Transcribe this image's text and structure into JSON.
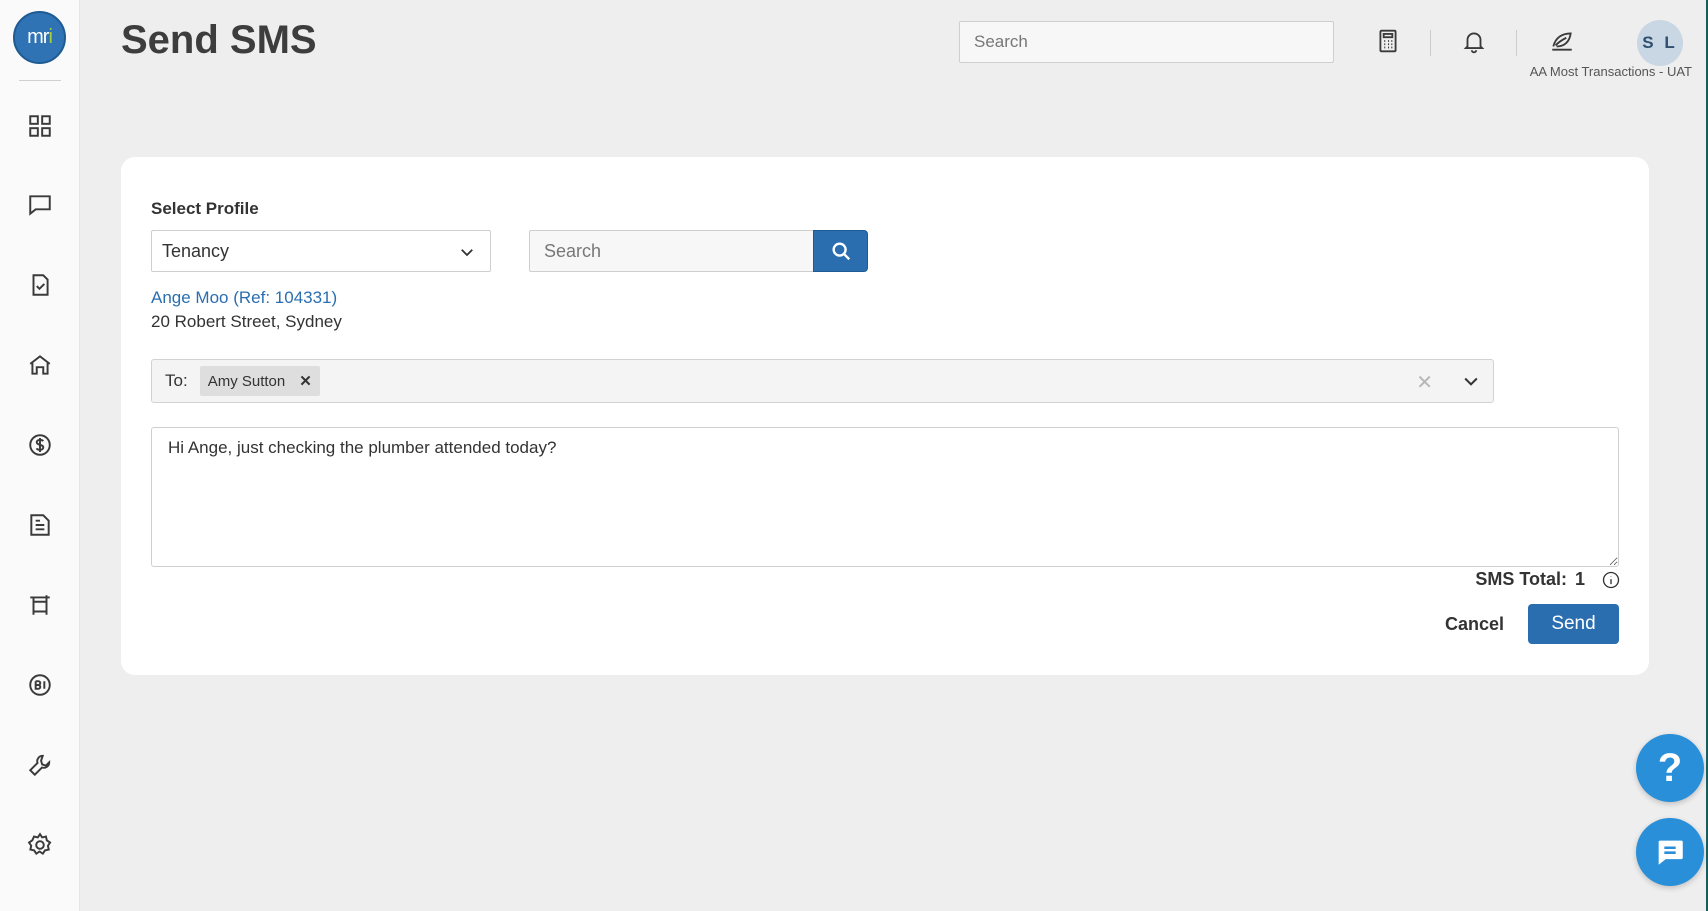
{
  "app": {
    "logo_text": "mri",
    "page_title": "Send SMS",
    "account_name": "AA Most Transactions - UAT",
    "user_initials": "S L"
  },
  "header": {
    "search_placeholder": "Search",
    "icons": [
      "calculator-icon",
      "bell-icon",
      "leaf-icon"
    ]
  },
  "sidebar": {
    "items": [
      {
        "name": "dashboard-icon"
      },
      {
        "name": "chat-icon"
      },
      {
        "name": "tasks-icon"
      },
      {
        "name": "property-icon"
      },
      {
        "name": "finance-icon"
      },
      {
        "name": "reports-icon"
      },
      {
        "name": "board-icon"
      },
      {
        "name": "bi-icon"
      },
      {
        "name": "tools-icon"
      },
      {
        "name": "settings-icon"
      }
    ]
  },
  "form": {
    "profile_label": "Select Profile",
    "profile_value": "Tenancy",
    "search_placeholder": "Search",
    "contact_link": "Ange Moo (Ref: 104331)",
    "contact_address": "20 Robert Street, Sydney",
    "to_label": "To:",
    "recipients": [
      "Amy Sutton"
    ],
    "message": "Hi Ange, just checking the plumber attended today?",
    "sms_total_label": "SMS Total:",
    "sms_total_value": "1",
    "cancel_label": "Cancel",
    "send_label": "Send"
  },
  "floating": {
    "help_label": "?"
  },
  "colors": {
    "primary": "#2a6eb0",
    "link": "#2a6eb0",
    "fab": "#2a8fd9",
    "background": "#eeeeee"
  }
}
